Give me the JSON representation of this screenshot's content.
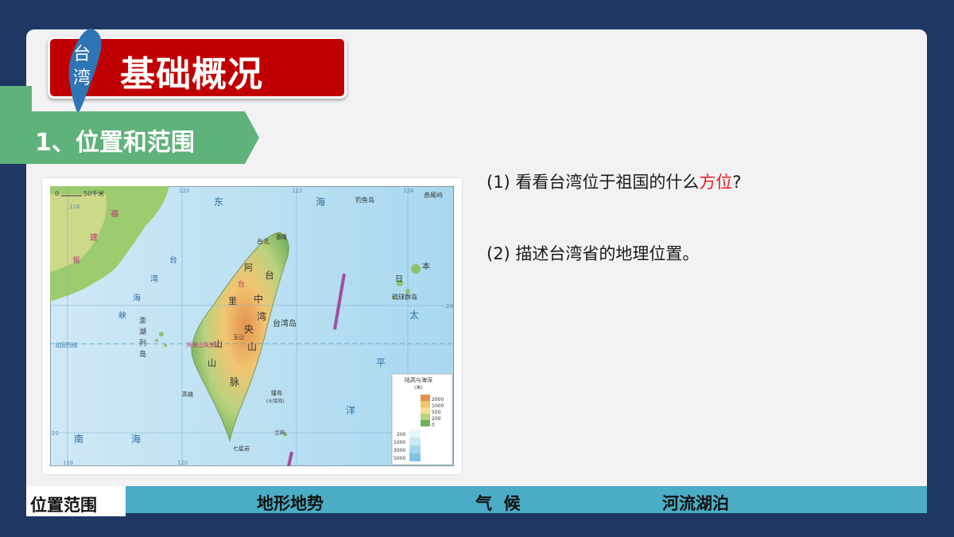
{
  "header": {
    "badge_line1": "台",
    "badge_line2": "湾",
    "title": "基础概况"
  },
  "section": {
    "label": "1、位置和范围"
  },
  "questions": {
    "q1_prefix": "(1) 看看台湾位于祖国的什么",
    "q1_highlight": "方位",
    "q1_suffix": "?",
    "q2": "(2) 描述台湾省的地理位置。"
  },
  "map": {
    "scale": "0",
    "scale_unit": "50千米",
    "lon_118": "118",
    "lon_120": "120",
    "lon_122": "122",
    "lon_124": "124",
    "lat_24": "24",
    "lat_22": "22",
    "east_sea": [
      "东",
      "海"
    ],
    "diaoyu": "钓鱼岛",
    "chiwei": "赤尾屿",
    "fujian": [
      "福",
      "建",
      "省"
    ],
    "strait": [
      "台",
      "湾",
      "海",
      "峡"
    ],
    "penghu": [
      "澎",
      "湖",
      "列",
      "岛"
    ],
    "tropic": "北回归线",
    "taipei": "台北",
    "keelung": "基隆",
    "alishan_range": [
      "阿",
      "里",
      "山",
      "山",
      "脉"
    ],
    "central_range": [
      "台",
      "湾",
      "中",
      "央",
      "山",
      "脉"
    ],
    "taiwan_island": "台湾岛",
    "yushan": "玉山",
    "alishan_area": "阿里山风景区",
    "gaoxiong": "高雄",
    "lvdao": "绿岛",
    "lvdao_note": "(火烧岛)",
    "lanyu": "兰屿",
    "qixing": "七星岩",
    "south_sea": [
      "南",
      "海"
    ],
    "pacific": [
      "太",
      "平",
      "洋"
    ],
    "japan": [
      "日",
      "本"
    ],
    "ryukyu": "琉球群岛",
    "legend_title": "陆高与海深",
    "legend_unit": "(米)",
    "legend_land": [
      "2000",
      "1000",
      "500",
      "200",
      "0"
    ],
    "legend_sea": [
      "200",
      "1000",
      "3000",
      "5000"
    ]
  },
  "nav": {
    "item1": "位置范围",
    "item2": "地形地势",
    "item3": "气  候",
    "item4": "河流湖泊"
  },
  "colors": {
    "background": "#1f3763",
    "banner_red": "#c00000",
    "banner_green": "#5fb27a",
    "nav_bar": "#4bacc6",
    "highlight": "#e02020"
  }
}
